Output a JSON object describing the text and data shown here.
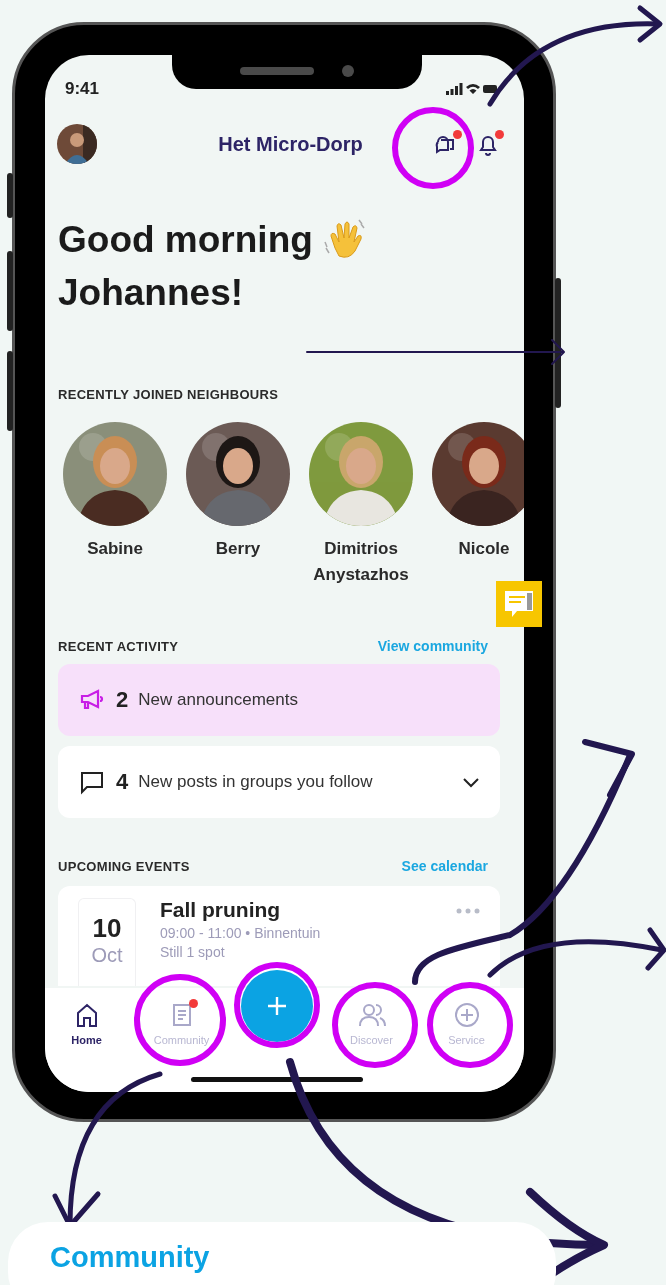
{
  "status_bar": {
    "time": "9:41"
  },
  "header": {
    "title": "Het Micro-Dorp",
    "chat_unread": true,
    "bell_unread": true
  },
  "greeting": {
    "line1": "Good morning",
    "line2": "Johannes!"
  },
  "neighbours": {
    "heading": "RECENTLY JOINED NEIGHBOURS",
    "people": [
      {
        "name": "Sabine",
        "kind": "picture"
      },
      {
        "name": "Berry",
        "kind": "picture"
      },
      {
        "name": "Dimitrios Anystazhos",
        "kind": "picture"
      },
      {
        "name": "Nicole",
        "kind": "picture"
      }
    ]
  },
  "activity": {
    "heading": "RECENT ACTIVITY",
    "link": "View community",
    "items": [
      {
        "kind": "announcement",
        "count": "2",
        "text": "New announcements"
      },
      {
        "kind": "posts",
        "count": "4",
        "text": "New posts in groups you follow",
        "expanded": false
      }
    ]
  },
  "events": {
    "heading": "UPCOMING EVENTS",
    "link": "See calendar",
    "items": [
      {
        "day": "10",
        "month": "Oct",
        "title": "Fall pruning",
        "details": "09:00 - 11:00 • Binnentuin",
        "note": "Still 1 spot"
      }
    ]
  },
  "nav": {
    "items": [
      {
        "kind": "home",
        "label": "Home",
        "selected": true,
        "badge": false
      },
      {
        "kind": "community",
        "label": "Community",
        "selected": false,
        "badge": true
      },
      {
        "kind": "add"
      },
      {
        "kind": "discover",
        "label": "Discover",
        "selected": false,
        "badge": false
      },
      {
        "kind": "service",
        "label": "Service",
        "selected": false,
        "badge": false
      }
    ]
  },
  "callout": {
    "title": "Community"
  }
}
